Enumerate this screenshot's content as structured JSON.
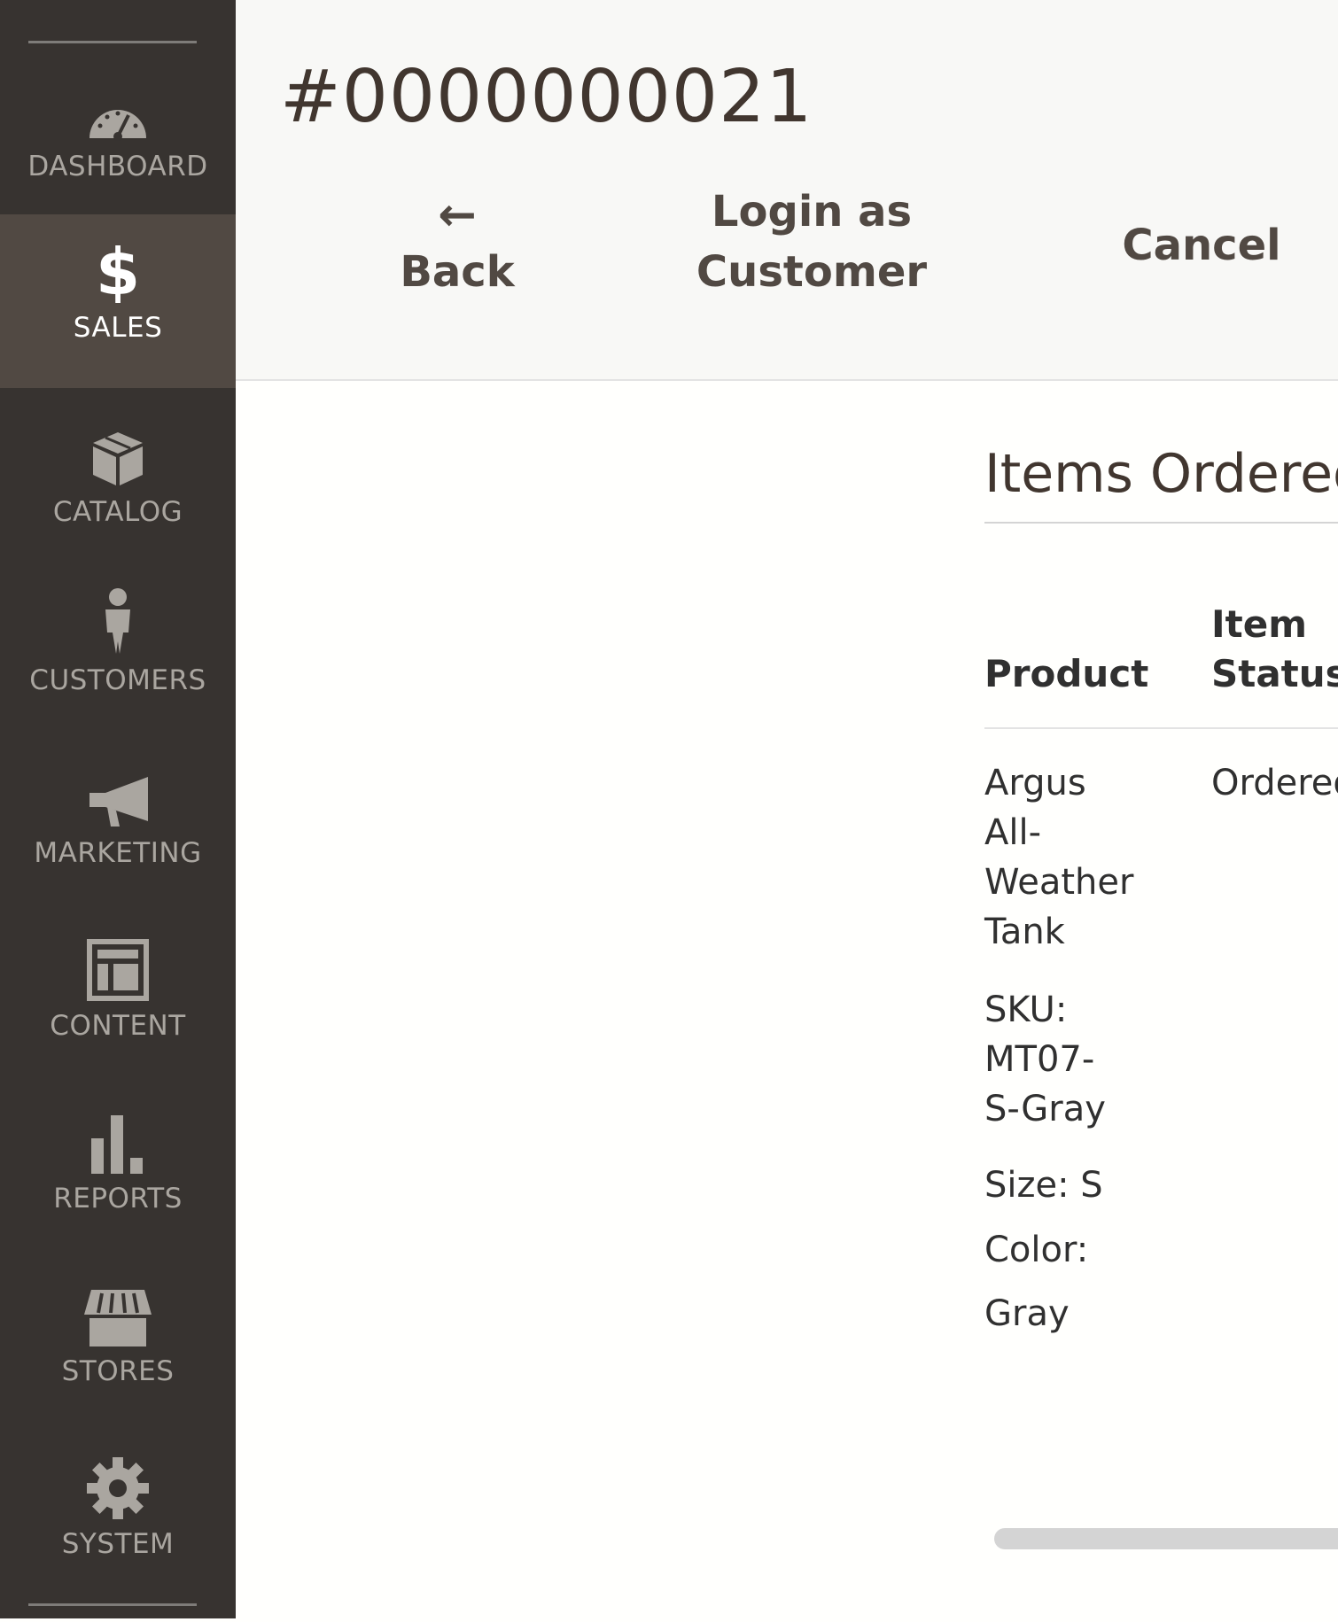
{
  "sidebar": {
    "items": [
      {
        "label": "DASHBOARD",
        "icon": "dashboard-icon",
        "active": false
      },
      {
        "label": "SALES",
        "icon": "dollar-icon",
        "active": true
      },
      {
        "label": "CATALOG",
        "icon": "box-icon",
        "active": false
      },
      {
        "label": "CUSTOMERS",
        "icon": "person-icon",
        "active": false
      },
      {
        "label": "MARKETING",
        "icon": "megaphone-icon",
        "active": false
      },
      {
        "label": "CONTENT",
        "icon": "layout-icon",
        "active": false
      },
      {
        "label": "REPORTS",
        "icon": "bar-chart-icon",
        "active": false
      },
      {
        "label": "STORES",
        "icon": "storefront-icon",
        "active": false
      },
      {
        "label": "SYSTEM",
        "icon": "gear-icon",
        "active": false
      }
    ]
  },
  "header": {
    "title": "#0000000021",
    "actions": {
      "back_arrow": "←",
      "back_label": "Back",
      "login_line1": "Login as",
      "login_line2": "Customer",
      "cancel_label": "Cancel"
    }
  },
  "items_ordered": {
    "title": "Items Ordered",
    "columns": {
      "product": "Product",
      "status_line1": "Item",
      "status_line2": "Status"
    },
    "rows": [
      {
        "product_name": "Argus All-Weather Tank",
        "sku": "SKU: MT07-S-Gray",
        "size": "Size: S",
        "color_label": "Color:",
        "color_value": "Gray",
        "status": "Ordered"
      }
    ]
  },
  "colors": {
    "sidebar_bg": "#373330",
    "sidebar_active_bg": "#514943",
    "header_bg": "#f8f8f6",
    "text_primary": "#303030",
    "button_text": "#514943"
  }
}
